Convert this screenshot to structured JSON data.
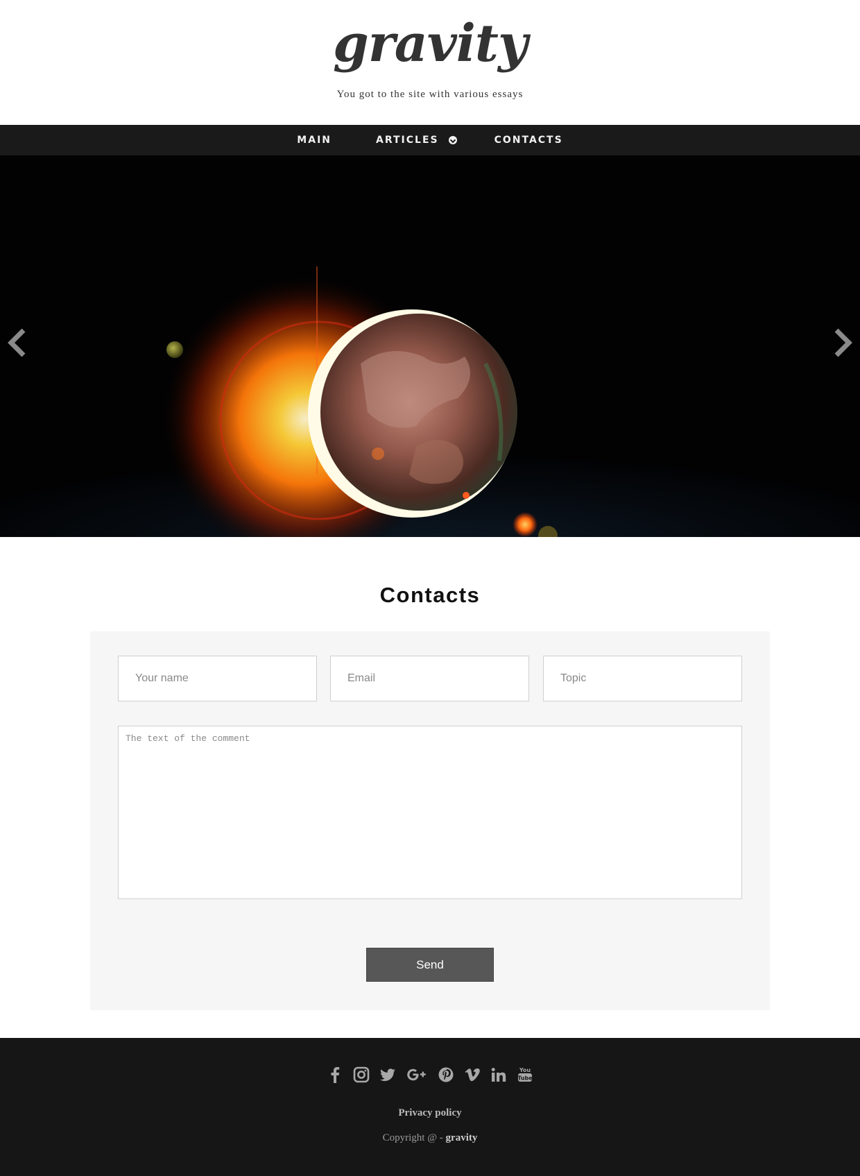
{
  "header": {
    "logo_text": "gravity",
    "tagline": "You got to the site with various essays"
  },
  "nav": {
    "items": [
      {
        "label": "MAIN"
      },
      {
        "label": "ARTICLES",
        "has_dropdown": true,
        "icon": "chevron-down-circle-icon"
      },
      {
        "label": "CONTACTS"
      }
    ]
  },
  "hero": {
    "image": "solar eclipse behind planet earth in space",
    "prev_icon": "chevron-left-icon",
    "next_icon": "chevron-right-icon"
  },
  "contacts": {
    "title": "Contacts",
    "fields": {
      "name_placeholder": "Your name",
      "email_placeholder": "Email",
      "topic_placeholder": "Topic",
      "comment_placeholder": "The text of the comment"
    },
    "send_label": "Send"
  },
  "footer": {
    "social_icons": [
      "facebook-icon",
      "instagram-icon",
      "twitter-icon",
      "google-plus-icon",
      "pinterest-icon",
      "vimeo-icon",
      "linkedin-icon",
      "youtube-icon"
    ],
    "privacy_label": "Privacy policy",
    "copyright_prefix": "Copyright @ - ",
    "copyright_brand": "gravity"
  },
  "colors": {
    "nav_bg": "#1a1a1a",
    "footer_bg": "#161616",
    "panel_bg": "#f6f6f6",
    "button_bg": "#575757",
    "icon_gray": "#a8a8a8"
  }
}
